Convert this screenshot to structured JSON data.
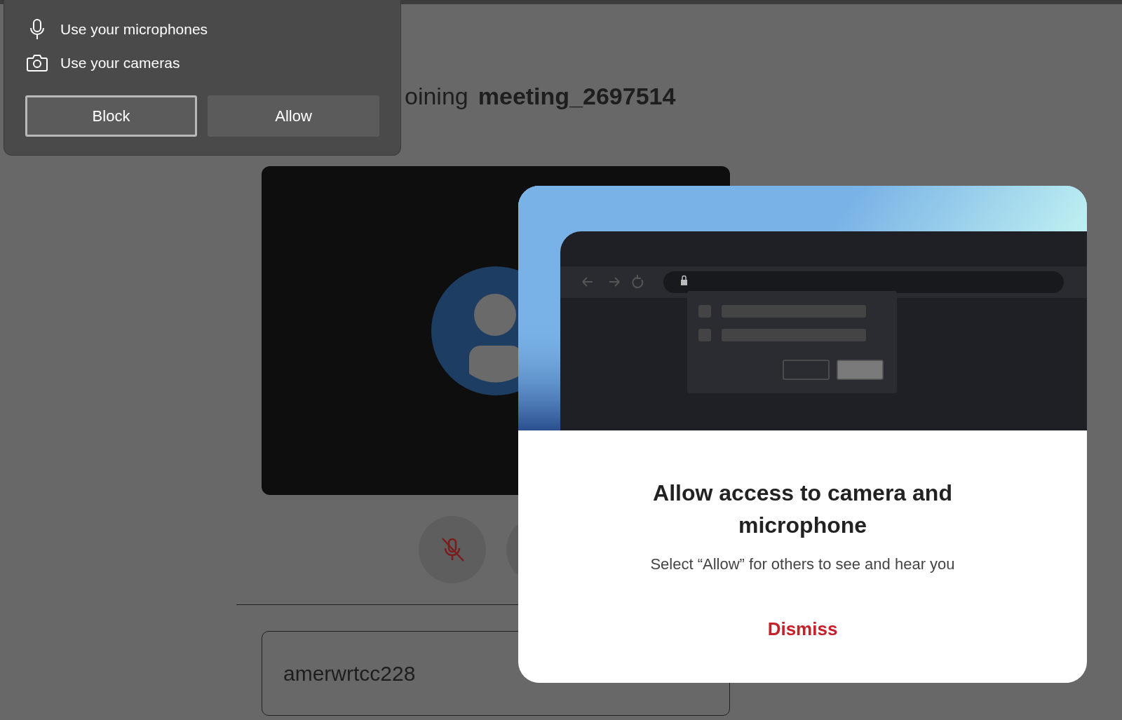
{
  "permission_prompt": {
    "items": [
      {
        "kind": "microphone",
        "label": "Use your microphones"
      },
      {
        "kind": "camera",
        "label": "Use your cameras"
      }
    ],
    "buttons": [
      {
        "label": "Block",
        "focused": true
      },
      {
        "label": "Allow",
        "focused": false
      }
    ]
  },
  "meeting": {
    "heading_prefix": "oining",
    "meeting_name": "meeting_2697514",
    "mic_muted": true,
    "name_field": {
      "value": "amerwrtcc228"
    }
  },
  "modal": {
    "title": "Allow access to camera and microphone",
    "subtitle": "Select “Allow” for others to see and hear you",
    "dismiss": "Dismiss"
  }
}
